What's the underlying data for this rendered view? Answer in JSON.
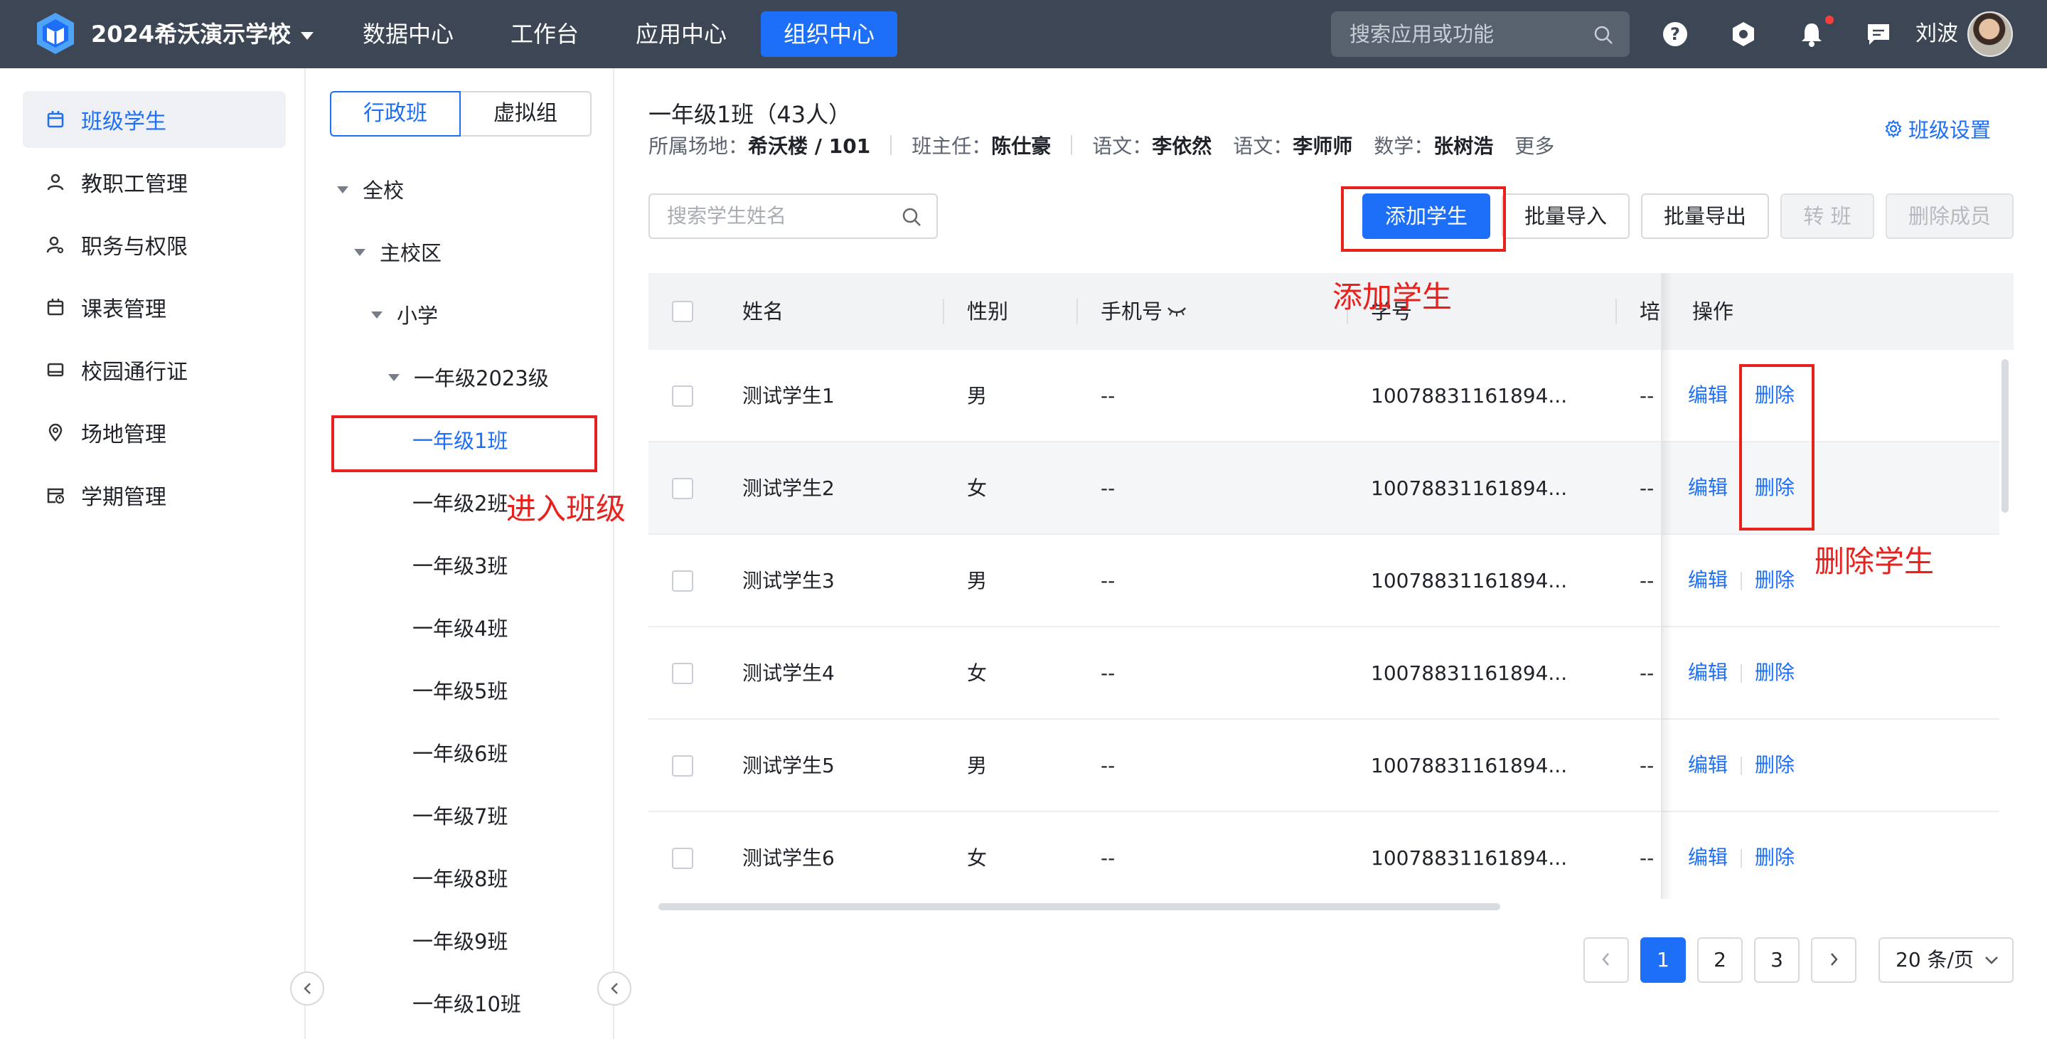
{
  "topbar": {
    "school_name": "2024希沃演示学校",
    "nav": [
      "数据中心",
      "工作台",
      "应用中心",
      "组织中心"
    ],
    "active_nav": "组织中心",
    "search_placeholder": "搜索应用或功能",
    "user_name": "刘波",
    "colors": {
      "bar": "#3c4654",
      "accent": "#1e6ff7",
      "notify_dot": "#f5403a"
    }
  },
  "left_menu": {
    "items": [
      {
        "label": "班级学生",
        "icon": "class-icon",
        "active": true
      },
      {
        "label": "教职工管理",
        "icon": "person-icon"
      },
      {
        "label": "职务与权限",
        "icon": "person-key-icon"
      },
      {
        "label": "课表管理",
        "icon": "calendar-icon"
      },
      {
        "label": "校园通行证",
        "icon": "card-icon"
      },
      {
        "label": "场地管理",
        "icon": "location-icon"
      },
      {
        "label": "学期管理",
        "icon": "calendar-clock-icon"
      }
    ]
  },
  "tree": {
    "segments": [
      "行政班",
      "虚拟组"
    ],
    "active_segment": "行政班",
    "nodes": [
      {
        "label": "全校",
        "expanded": true
      },
      {
        "label": "主校区",
        "expanded": true
      },
      {
        "label": "小学",
        "expanded": true
      },
      {
        "label": "一年级2023级",
        "expanded": true
      },
      {
        "label": "一年级1班",
        "selected": true
      },
      {
        "label": "一年级2班"
      },
      {
        "label": "一年级3班"
      },
      {
        "label": "一年级4班"
      },
      {
        "label": "一年级5班"
      },
      {
        "label": "一年级6班"
      },
      {
        "label": "一年级7班"
      },
      {
        "label": "一年级8班"
      },
      {
        "label": "一年级9班"
      },
      {
        "label": "一年级10班"
      }
    ]
  },
  "class_info": {
    "title": "一年级1班（43人）",
    "fields": [
      {
        "label": "所属场地：",
        "value": "希沃楼 / 101"
      },
      {
        "label": "班主任：",
        "value": "陈仕豪"
      },
      {
        "label": "语文：",
        "value": "李依然"
      },
      {
        "label": "语文：",
        "value": "李师师"
      },
      {
        "label": "数学：",
        "value": "张树浩"
      }
    ],
    "more": "更多",
    "settings": "班级设置"
  },
  "toolbar": {
    "search_placeholder": "搜索学生姓名",
    "add": "添加学生",
    "import": "批量导入",
    "export": "批量导出",
    "transfer": "转 班",
    "remove": "删除成员"
  },
  "table": {
    "columns": [
      "姓名",
      "性别",
      "手机号",
      "学号",
      "培",
      "操作"
    ],
    "rows": [
      {
        "name": "测试学生1",
        "gender": "男",
        "phone": "--",
        "student_id": "10078831161894...",
        "extra": "--"
      },
      {
        "name": "测试学生2",
        "gender": "女",
        "phone": "--",
        "student_id": "10078831161894...",
        "extra": "--"
      },
      {
        "name": "测试学生3",
        "gender": "男",
        "phone": "--",
        "student_id": "10078831161894...",
        "extra": "--"
      },
      {
        "name": "测试学生4",
        "gender": "女",
        "phone": "--",
        "student_id": "10078831161894...",
        "extra": "--"
      },
      {
        "name": "测试学生5",
        "gender": "男",
        "phone": "--",
        "student_id": "10078831161894...",
        "extra": "--"
      },
      {
        "name": "测试学生6",
        "gender": "女",
        "phone": "--",
        "student_id": "10078831161894...",
        "extra": "--"
      }
    ],
    "edit": "编辑",
    "delete": "删除"
  },
  "pagination": {
    "pages": [
      "1",
      "2",
      "3"
    ],
    "current": "1",
    "page_size": "20 条/页"
  },
  "annotations": {
    "add_student": "添加学生",
    "enter_class": "进入班级",
    "delete_student": "删除学生"
  }
}
